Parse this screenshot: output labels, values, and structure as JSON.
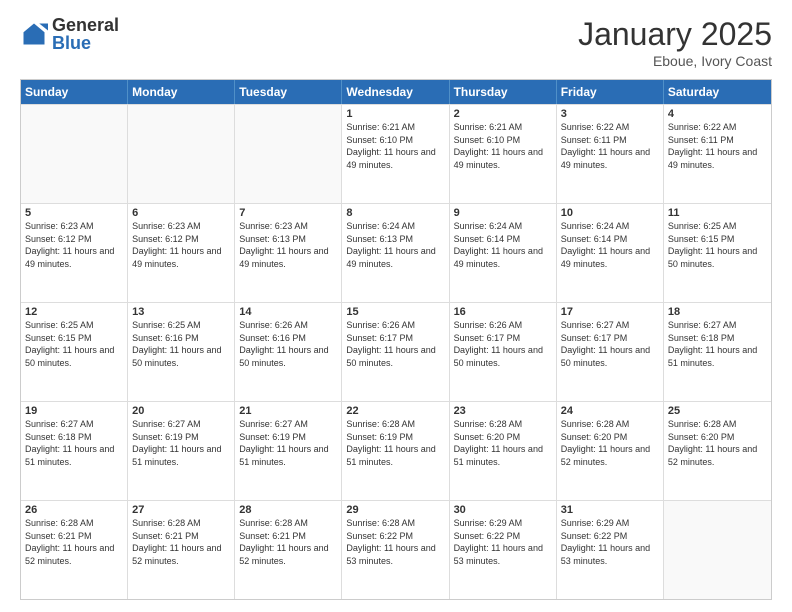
{
  "header": {
    "logo_general": "General",
    "logo_blue": "Blue",
    "month_title": "January 2025",
    "subtitle": "Eboue, Ivory Coast"
  },
  "days_of_week": [
    "Sunday",
    "Monday",
    "Tuesday",
    "Wednesday",
    "Thursday",
    "Friday",
    "Saturday"
  ],
  "weeks": [
    [
      {
        "day": "",
        "info": ""
      },
      {
        "day": "",
        "info": ""
      },
      {
        "day": "",
        "info": ""
      },
      {
        "day": "1",
        "info": "Sunrise: 6:21 AM\nSunset: 6:10 PM\nDaylight: 11 hours and 49 minutes."
      },
      {
        "day": "2",
        "info": "Sunrise: 6:21 AM\nSunset: 6:10 PM\nDaylight: 11 hours and 49 minutes."
      },
      {
        "day": "3",
        "info": "Sunrise: 6:22 AM\nSunset: 6:11 PM\nDaylight: 11 hours and 49 minutes."
      },
      {
        "day": "4",
        "info": "Sunrise: 6:22 AM\nSunset: 6:11 PM\nDaylight: 11 hours and 49 minutes."
      }
    ],
    [
      {
        "day": "5",
        "info": "Sunrise: 6:23 AM\nSunset: 6:12 PM\nDaylight: 11 hours and 49 minutes."
      },
      {
        "day": "6",
        "info": "Sunrise: 6:23 AM\nSunset: 6:12 PM\nDaylight: 11 hours and 49 minutes."
      },
      {
        "day": "7",
        "info": "Sunrise: 6:23 AM\nSunset: 6:13 PM\nDaylight: 11 hours and 49 minutes."
      },
      {
        "day": "8",
        "info": "Sunrise: 6:24 AM\nSunset: 6:13 PM\nDaylight: 11 hours and 49 minutes."
      },
      {
        "day": "9",
        "info": "Sunrise: 6:24 AM\nSunset: 6:14 PM\nDaylight: 11 hours and 49 minutes."
      },
      {
        "day": "10",
        "info": "Sunrise: 6:24 AM\nSunset: 6:14 PM\nDaylight: 11 hours and 49 minutes."
      },
      {
        "day": "11",
        "info": "Sunrise: 6:25 AM\nSunset: 6:15 PM\nDaylight: 11 hours and 50 minutes."
      }
    ],
    [
      {
        "day": "12",
        "info": "Sunrise: 6:25 AM\nSunset: 6:15 PM\nDaylight: 11 hours and 50 minutes."
      },
      {
        "day": "13",
        "info": "Sunrise: 6:25 AM\nSunset: 6:16 PM\nDaylight: 11 hours and 50 minutes."
      },
      {
        "day": "14",
        "info": "Sunrise: 6:26 AM\nSunset: 6:16 PM\nDaylight: 11 hours and 50 minutes."
      },
      {
        "day": "15",
        "info": "Sunrise: 6:26 AM\nSunset: 6:17 PM\nDaylight: 11 hours and 50 minutes."
      },
      {
        "day": "16",
        "info": "Sunrise: 6:26 AM\nSunset: 6:17 PM\nDaylight: 11 hours and 50 minutes."
      },
      {
        "day": "17",
        "info": "Sunrise: 6:27 AM\nSunset: 6:17 PM\nDaylight: 11 hours and 50 minutes."
      },
      {
        "day": "18",
        "info": "Sunrise: 6:27 AM\nSunset: 6:18 PM\nDaylight: 11 hours and 51 minutes."
      }
    ],
    [
      {
        "day": "19",
        "info": "Sunrise: 6:27 AM\nSunset: 6:18 PM\nDaylight: 11 hours and 51 minutes."
      },
      {
        "day": "20",
        "info": "Sunrise: 6:27 AM\nSunset: 6:19 PM\nDaylight: 11 hours and 51 minutes."
      },
      {
        "day": "21",
        "info": "Sunrise: 6:27 AM\nSunset: 6:19 PM\nDaylight: 11 hours and 51 minutes."
      },
      {
        "day": "22",
        "info": "Sunrise: 6:28 AM\nSunset: 6:19 PM\nDaylight: 11 hours and 51 minutes."
      },
      {
        "day": "23",
        "info": "Sunrise: 6:28 AM\nSunset: 6:20 PM\nDaylight: 11 hours and 51 minutes."
      },
      {
        "day": "24",
        "info": "Sunrise: 6:28 AM\nSunset: 6:20 PM\nDaylight: 11 hours and 52 minutes."
      },
      {
        "day": "25",
        "info": "Sunrise: 6:28 AM\nSunset: 6:20 PM\nDaylight: 11 hours and 52 minutes."
      }
    ],
    [
      {
        "day": "26",
        "info": "Sunrise: 6:28 AM\nSunset: 6:21 PM\nDaylight: 11 hours and 52 minutes."
      },
      {
        "day": "27",
        "info": "Sunrise: 6:28 AM\nSunset: 6:21 PM\nDaylight: 11 hours and 52 minutes."
      },
      {
        "day": "28",
        "info": "Sunrise: 6:28 AM\nSunset: 6:21 PM\nDaylight: 11 hours and 52 minutes."
      },
      {
        "day": "29",
        "info": "Sunrise: 6:28 AM\nSunset: 6:22 PM\nDaylight: 11 hours and 53 minutes."
      },
      {
        "day": "30",
        "info": "Sunrise: 6:29 AM\nSunset: 6:22 PM\nDaylight: 11 hours and 53 minutes."
      },
      {
        "day": "31",
        "info": "Sunrise: 6:29 AM\nSunset: 6:22 PM\nDaylight: 11 hours and 53 minutes."
      },
      {
        "day": "",
        "info": ""
      }
    ]
  ]
}
